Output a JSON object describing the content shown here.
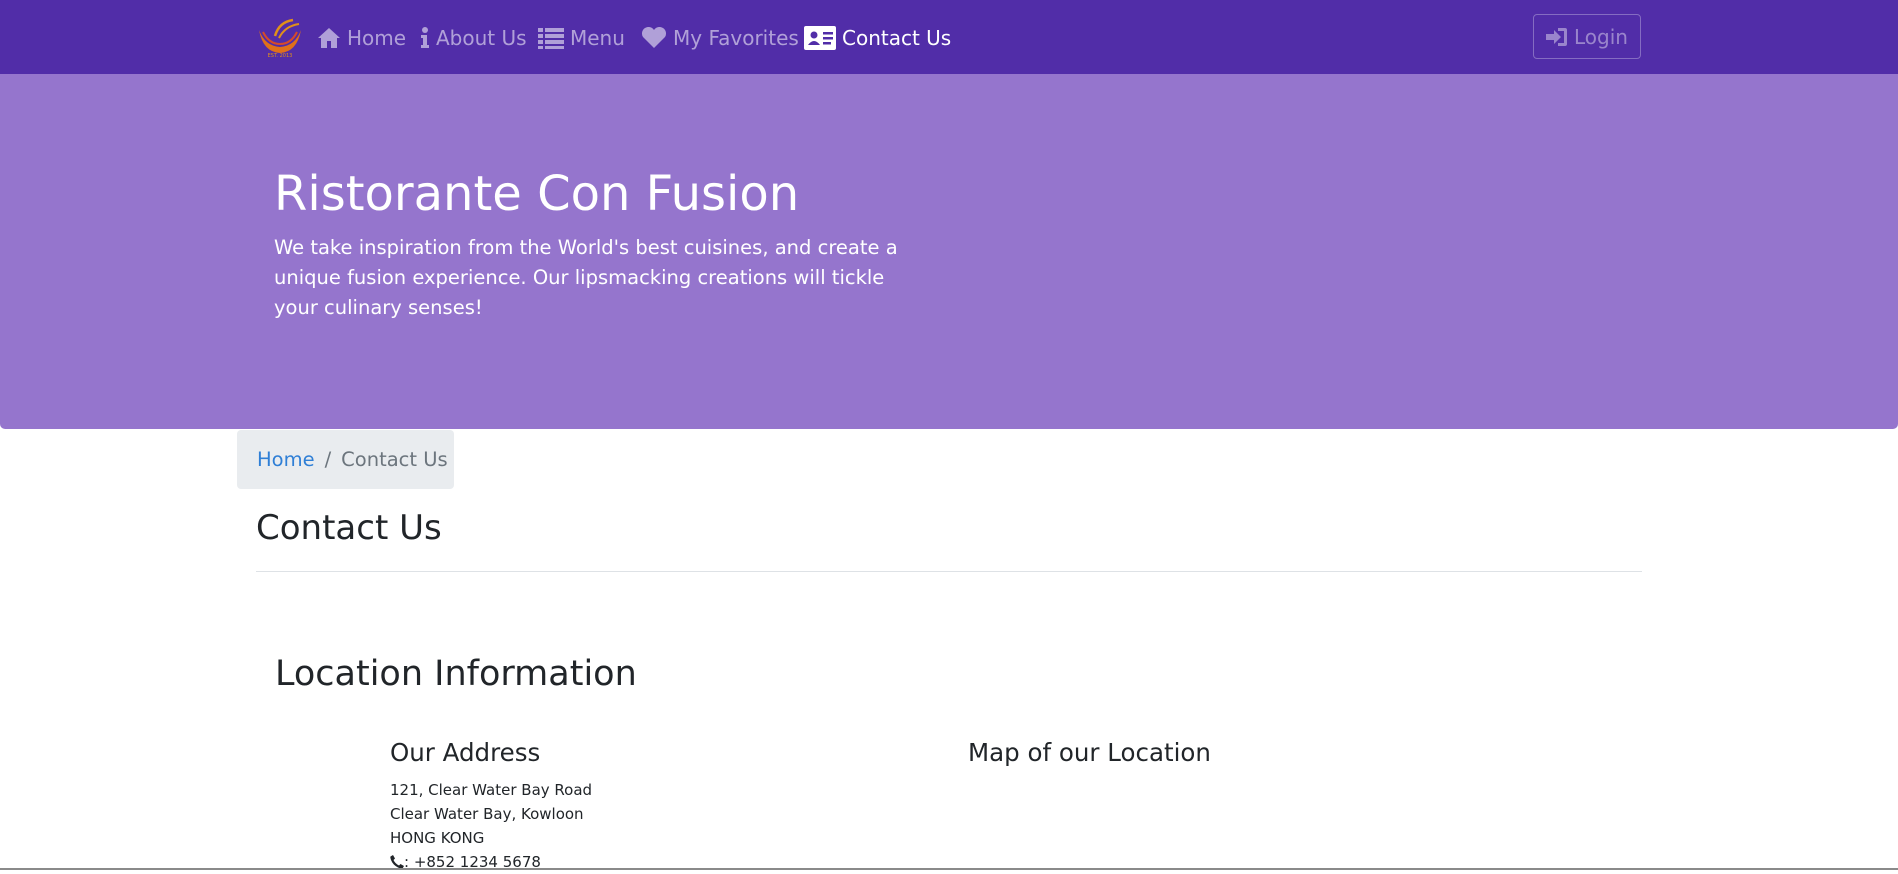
{
  "nav": {
    "items": [
      {
        "label": "Home",
        "icon": "home-icon"
      },
      {
        "label": "About Us",
        "icon": "info-icon"
      },
      {
        "label": "Menu",
        "icon": "list-icon"
      },
      {
        "label": "My Favorites",
        "icon": "heart-icon"
      },
      {
        "label": "Contact Us",
        "icon": "address-card-icon",
        "active": true
      }
    ],
    "login_label": "Login"
  },
  "hero": {
    "title": "Ristorante Con Fusion",
    "text": "We take inspiration from the World's best cuisines, and create a unique fusion experience. Our lipsmacking creations will tickle your culinary senses!"
  },
  "breadcrumb": {
    "home": "Home",
    "separator": "/",
    "current": "Contact Us"
  },
  "page_title": "Contact Us",
  "location": {
    "title": "Location Information",
    "address_heading": "Our Address",
    "address_lines": [
      "121, Clear Water Bay Road",
      "Clear Water Bay, Kowloon",
      "HONG KONG"
    ],
    "phone": ": +852 1234 5678",
    "map_heading": "Map of our Location"
  },
  "colors": {
    "navbar": "#512da8",
    "jumbotron": "#9575cd",
    "link": "#2f7fd6"
  }
}
